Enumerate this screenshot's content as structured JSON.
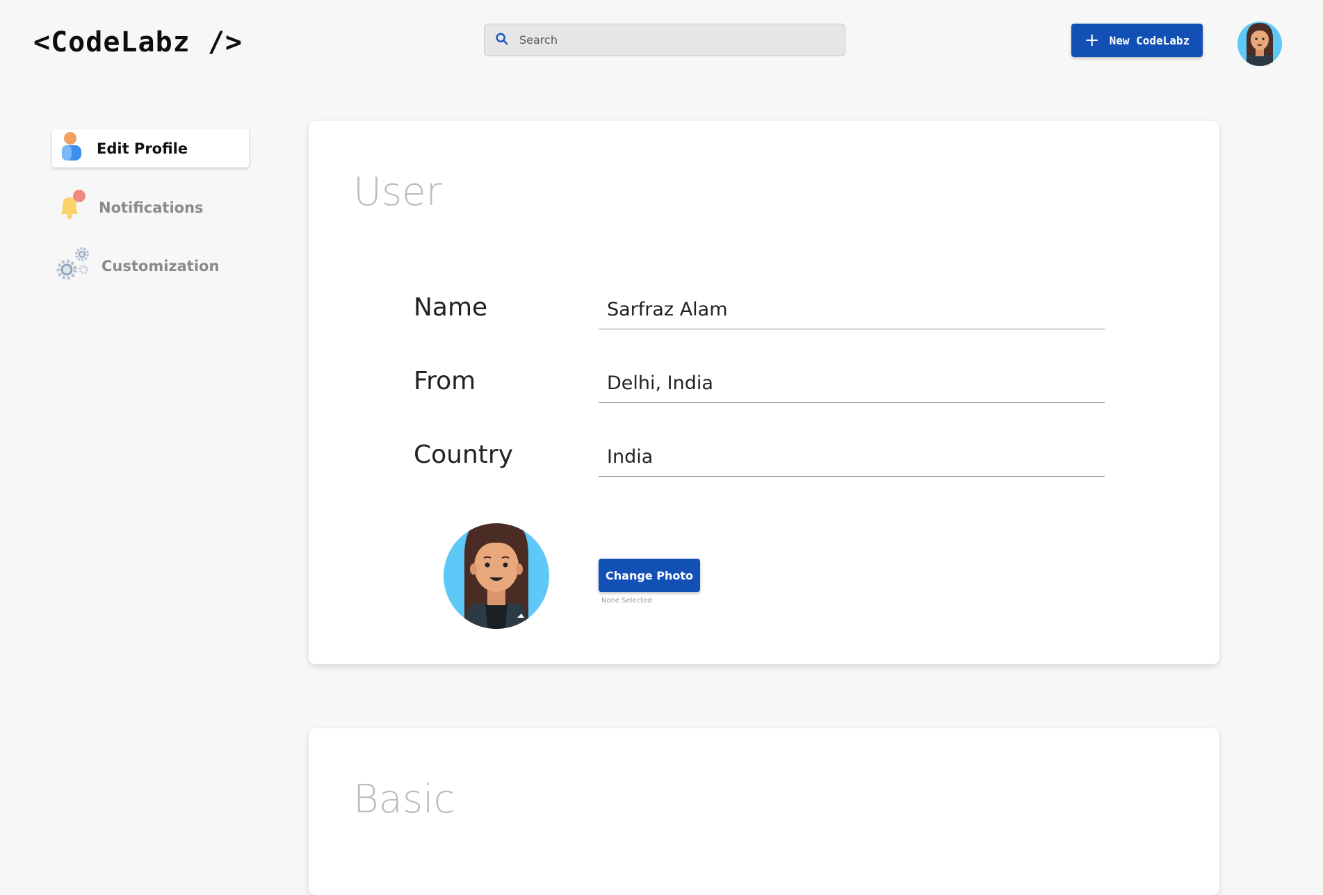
{
  "header": {
    "logo": "<CodeLabz />",
    "search_placeholder": "Search",
    "new_button_label": "New CodeLabz"
  },
  "sidebar": {
    "items": [
      {
        "label": "Edit Profile",
        "icon": "user-icon",
        "active": true
      },
      {
        "label": "Notifications",
        "icon": "bell-icon",
        "active": false
      },
      {
        "label": "Customization",
        "icon": "gears-icon",
        "active": false
      }
    ]
  },
  "user_section": {
    "title": "User",
    "fields": [
      {
        "label": "Name",
        "value": "Sarfraz Alam"
      },
      {
        "label": "From",
        "value": "Delhi, India"
      },
      {
        "label": "Country",
        "value": "India"
      }
    ],
    "change_photo_label": "Change Photo",
    "file_status": "None Selected"
  },
  "basic_section": {
    "title": "Basic"
  },
  "colors": {
    "accent": "#1250b5",
    "background": "#f7f7f7",
    "avatar_bg": "#5ec8f8"
  }
}
